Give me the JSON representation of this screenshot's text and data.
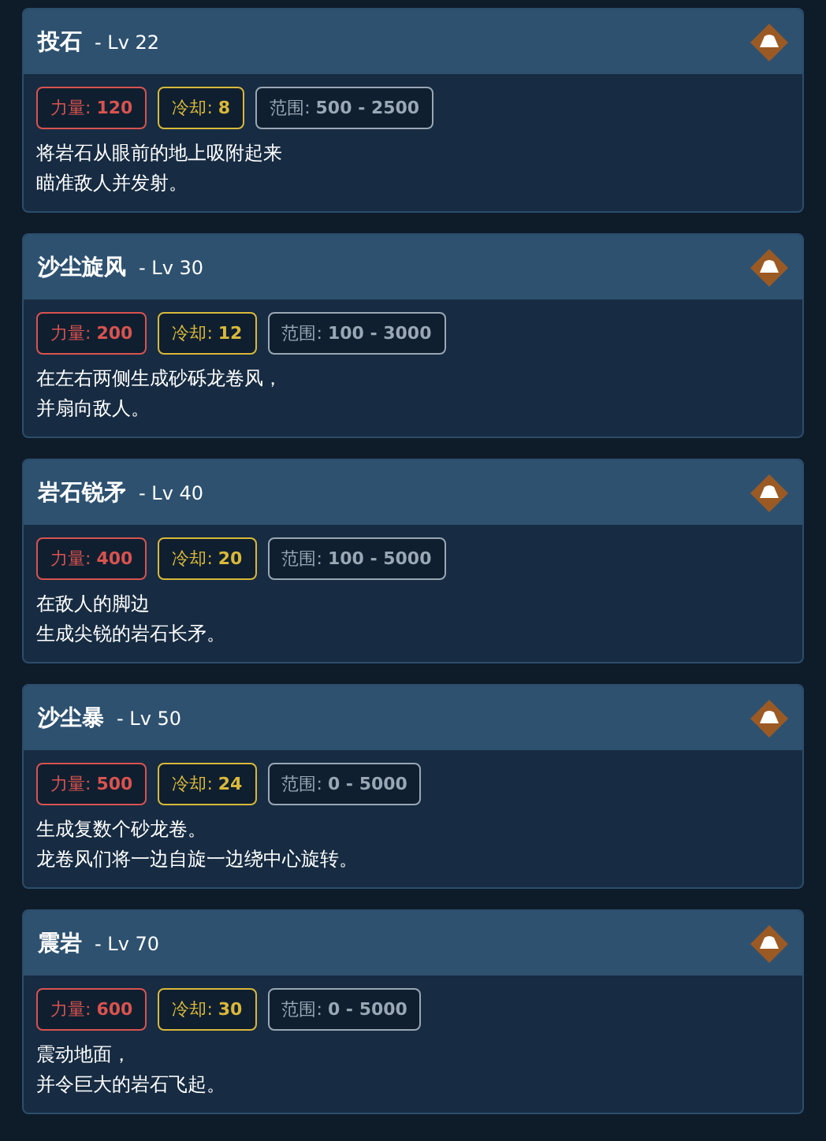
{
  "skills": [
    {
      "name": "投石",
      "level": "- Lv 22",
      "stats": [
        {
          "kind": "power",
          "label": "力量:",
          "value": "120"
        },
        {
          "kind": "cooldown",
          "label": "冷却:",
          "value": "8"
        },
        {
          "kind": "range",
          "label": "范围:",
          "value": "500 - 2500"
        }
      ],
      "description": [
        "将岩石从眼前的地上吸附起来",
        "瞄准敌人并发射。"
      ]
    },
    {
      "name": "沙尘旋风",
      "level": "- Lv 30",
      "stats": [
        {
          "kind": "power",
          "label": "力量:",
          "value": "200"
        },
        {
          "kind": "cooldown",
          "label": "冷却:",
          "value": "12"
        },
        {
          "kind": "range",
          "label": "范围:",
          "value": "100 - 3000"
        }
      ],
      "description": [
        "在左右两侧生成砂砾龙卷风，",
        "并扇向敌人。"
      ]
    },
    {
      "name": "岩石锐矛",
      "level": "- Lv 40",
      "stats": [
        {
          "kind": "power",
          "label": "力量:",
          "value": "400"
        },
        {
          "kind": "cooldown",
          "label": "冷却:",
          "value": "20"
        },
        {
          "kind": "range",
          "label": "范围:",
          "value": "100 - 5000"
        }
      ],
      "description": [
        "在敌人的脚边",
        "生成尖锐的岩石长矛。"
      ]
    },
    {
      "name": "沙尘暴",
      "level": "- Lv 50",
      "stats": [
        {
          "kind": "power",
          "label": "力量:",
          "value": "500"
        },
        {
          "kind": "cooldown",
          "label": "冷却:",
          "value": "24"
        },
        {
          "kind": "range",
          "label": "范围:",
          "value": "0 - 5000"
        }
      ],
      "description": [
        "生成复数个砂龙卷。",
        "龙卷风们将一边自旋一边绕中心旋转。"
      ]
    },
    {
      "name": "震岩",
      "level": "- Lv 70",
      "stats": [
        {
          "kind": "power",
          "label": "力量:",
          "value": "600"
        },
        {
          "kind": "cooldown",
          "label": "冷却:",
          "value": "30"
        },
        {
          "kind": "range",
          "label": "范围:",
          "value": "0 - 5000"
        }
      ],
      "description": [
        "震动地面，",
        "并令巨大的岩石飞起。"
      ]
    }
  ]
}
